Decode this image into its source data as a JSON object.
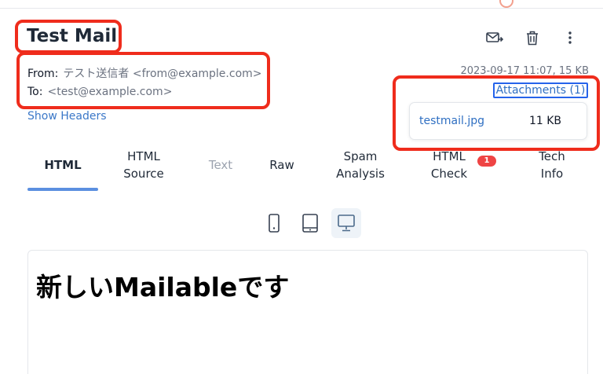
{
  "message": {
    "subject": "Test Mail",
    "from_label": "From:",
    "from_value": "テスト送信者 <from@example.com>",
    "to_label": "To:",
    "to_value": "<test@example.com>",
    "date_size": "2023-09-17 11:07, 15 KB",
    "show_headers": "Show Headers"
  },
  "attachments": {
    "link_label": "Attachments (1)",
    "items": [
      {
        "name": "testmail.jpg",
        "size": "11 KB"
      }
    ]
  },
  "actions": [
    {
      "icon": "forward-mail-icon"
    },
    {
      "icon": "trash-icon"
    },
    {
      "icon": "more-vertical-icon"
    }
  ],
  "tabs": [
    {
      "line1": "HTML",
      "line2": "",
      "state": "active"
    },
    {
      "line1": "HTML",
      "line2": "Source",
      "state": "normal"
    },
    {
      "line1": "Text",
      "line2": "",
      "state": "disabled"
    },
    {
      "line1": "Raw",
      "line2": "",
      "state": "normal"
    },
    {
      "line1": "Spam",
      "line2": "Analysis",
      "state": "normal"
    },
    {
      "line1": "HTML",
      "line2": "Check",
      "state": "normal",
      "badge": "1"
    },
    {
      "line1": "Tech",
      "line2": "Info",
      "state": "normal"
    }
  ],
  "devices": [
    {
      "icon": "phone-icon",
      "active": false
    },
    {
      "icon": "tablet-icon",
      "active": false
    },
    {
      "icon": "desktop-icon",
      "active": true
    }
  ],
  "preview": {
    "body_text": "新しいMailableです"
  },
  "colors": {
    "highlight": "#ef2c1c",
    "link": "#2f6fc2",
    "badge": "#ef4444",
    "active_tab": "#5b8fe0"
  }
}
